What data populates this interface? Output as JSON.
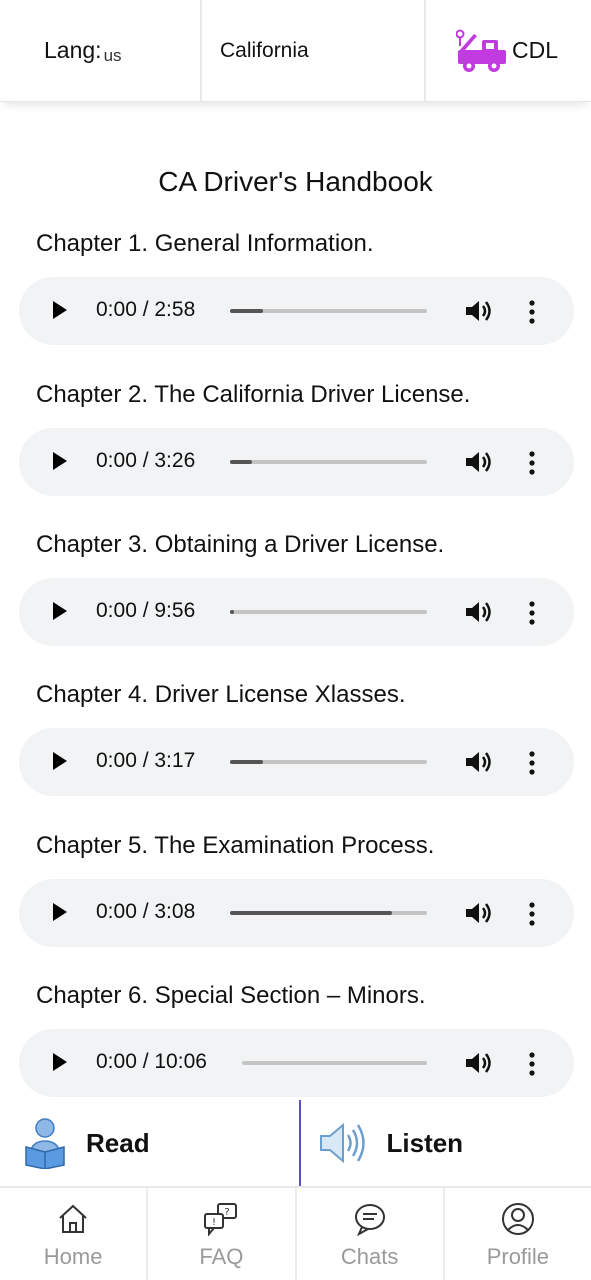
{
  "header": {
    "lang_label": "Lang:",
    "lang_code": "us",
    "state": "California",
    "cdl_label": "CDL",
    "cdl_icon": "tow-truck-icon",
    "cdl_icon_color": "#c23be0"
  },
  "page_title": "CA Driver's Handbook",
  "chapters": [
    {
      "title": "Chapter 1. General Information.",
      "time": "0:00 / 2:58",
      "progress": 0.17
    },
    {
      "title": "Chapter 2. The California Driver License.",
      "time": "0:00 / 3:26",
      "progress": 0.11
    },
    {
      "title": "Chapter 3. Obtaining a Driver License.",
      "time": "0:00 / 9:56",
      "progress": 0.02
    },
    {
      "title": "Chapter 4. Driver License Xlasses.",
      "time": "0:00 / 3:17",
      "progress": 0.17
    },
    {
      "title": "Chapter 5. The Examination Process.",
      "time": "0:00 / 3:08",
      "progress": 0.82
    },
    {
      "title": "Chapter 6. Special Section – Minors.",
      "time": "0:00 / 10:06",
      "progress": 0.0
    }
  ],
  "mode_bar": {
    "read_label": "Read",
    "listen_label": "Listen",
    "divider_color": "#5b4fc4"
  },
  "nav": {
    "home": "Home",
    "faq": "FAQ",
    "chats": "Chats",
    "profile": "Profile"
  }
}
